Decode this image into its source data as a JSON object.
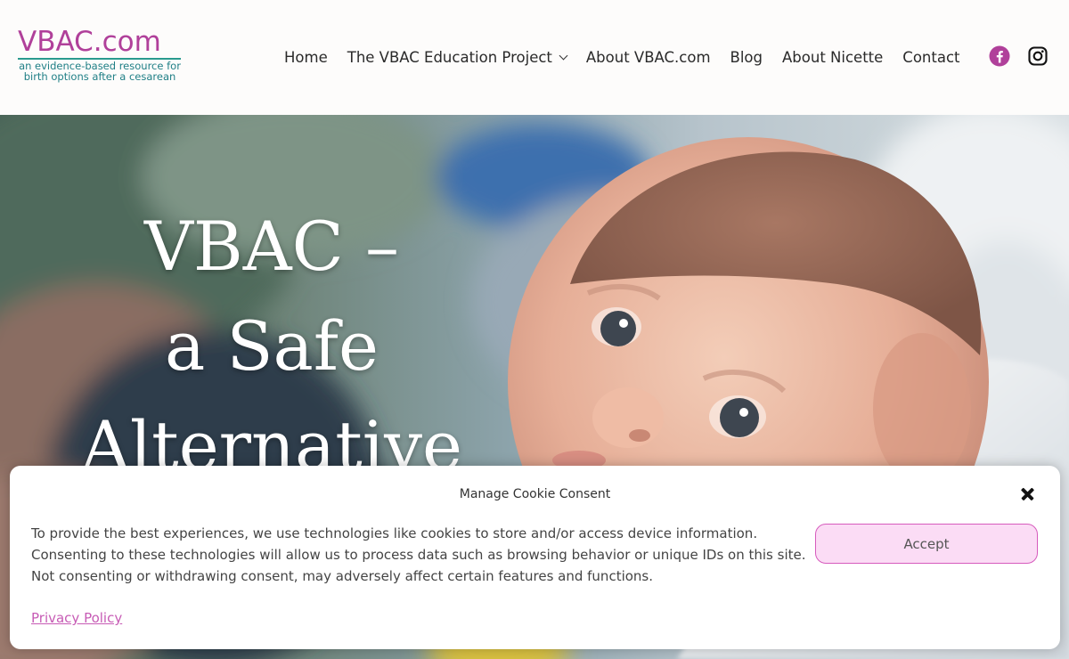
{
  "header": {
    "logo_title": "VBAC.com",
    "logo_tagline_line1": "an evidence-based resource for",
    "logo_tagline_line2": "birth options after a cesarean"
  },
  "nav": {
    "items": [
      {
        "label": "Home"
      },
      {
        "label": "The VBAC Education Project",
        "has_dropdown": true
      },
      {
        "label": "About VBAC.com"
      },
      {
        "label": "Blog"
      },
      {
        "label": "About Nicette"
      },
      {
        "label": "Contact"
      }
    ]
  },
  "social": [
    {
      "icon": "facebook-icon",
      "color": "#b0409a"
    },
    {
      "icon": "instagram-icon",
      "color": "#111111"
    }
  ],
  "hero": {
    "title_line1": "VBAC –",
    "title_line2": "a Safe",
    "title_line3": "Alternative"
  },
  "cookie": {
    "title": "Manage Cookie Consent",
    "body": "To provide the best experiences, we use technologies like cookies to store and/or access device information. Consenting to these technologies will allow us to process data such as browsing behavior or unique IDs on this site. Not consenting or withdrawing consent, may adversely affect certain features and functions.",
    "accept_label": "Accept",
    "privacy_label": "Privacy Policy"
  },
  "colors": {
    "brand_pink": "#b0409a",
    "brand_teal": "#1f7f86",
    "accept_bg": "#fbdcf5",
    "accept_border": "#d65bbd"
  }
}
